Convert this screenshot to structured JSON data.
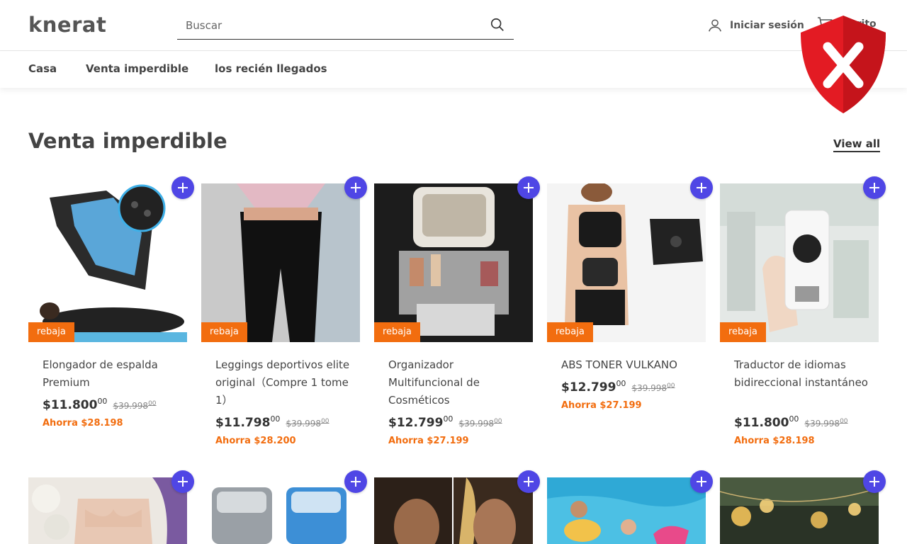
{
  "header": {
    "logo": "knerat",
    "search_placeholder": "Buscar",
    "login_label": "Iniciar sesión",
    "cart_label": "Carrito"
  },
  "nav": {
    "items": [
      "Casa",
      "Venta imperdible",
      "los recién llegados"
    ]
  },
  "section": {
    "title": "Venta imperdible",
    "view_all": "View all"
  },
  "colors": {
    "accent_badge": "#f26d0f",
    "add_button": "#4f46e5",
    "shield_red": "#e31b23"
  },
  "products": [
    {
      "title": "Elongador de espalda Premium",
      "badge": "rebaja",
      "price": "$11.800",
      "price_cents": "00",
      "old_price": "$39.998",
      "old_cents": "00",
      "save": "Ahorra $28.198"
    },
    {
      "title": "Leggings deportivos elite original（Compre 1 tome 1）",
      "badge": "rebaja",
      "price": "$11.798",
      "price_cents": "00",
      "old_price": "$39.998",
      "old_cents": "00",
      "save": "Ahorra $28.200"
    },
    {
      "title": "Organizador Multifuncional de Cosméticos",
      "badge": "rebaja",
      "price": "$12.799",
      "price_cents": "00",
      "old_price": "$39.998",
      "old_cents": "00",
      "save": "Ahorra $27.199"
    },
    {
      "title": "ABS TONER VULKANO",
      "badge": "rebaja",
      "price": "$12.799",
      "price_cents": "00",
      "old_price": "$39.998",
      "old_cents": "00",
      "save": "Ahorra $27.199"
    },
    {
      "title": "Traductor de idiomas bidireccional instantáneo",
      "badge": "rebaja",
      "price": "$11.800",
      "price_cents": "00",
      "old_price": "$39.998",
      "old_cents": "00",
      "save": "Ahorra $28.198"
    }
  ]
}
